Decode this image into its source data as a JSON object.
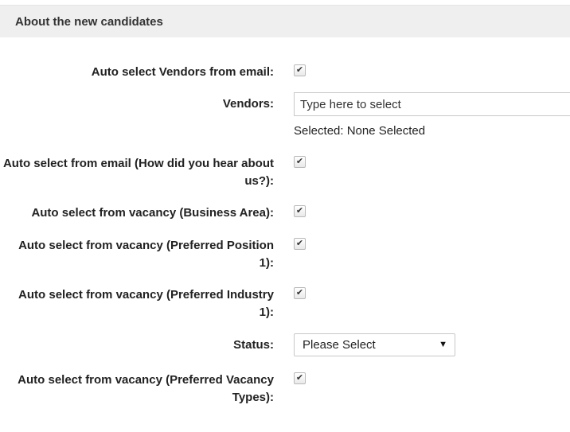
{
  "section": {
    "title": "About the new candidates"
  },
  "fields": {
    "auto_vendors": {
      "label": "Auto select Vendors from email:",
      "checked": true
    },
    "vendors": {
      "label": "Vendors:",
      "placeholder": "Type here to select",
      "selected_text": "Selected: None Selected"
    },
    "auto_hear": {
      "label_line1": "Auto select from email (How did you hear about",
      "label_line2": "us?):",
      "checked": true
    },
    "auto_business_area": {
      "label": "Auto select from vacancy (Business Area):",
      "checked": true
    },
    "auto_pref_position": {
      "label_line1": "Auto select from vacancy (Preferred Position",
      "label_line2": "1):",
      "checked": true
    },
    "auto_pref_industry": {
      "label_line1": "Auto select from vacancy (Preferred Industry",
      "label_line2": "1):",
      "checked": true
    },
    "status": {
      "label": "Status:",
      "value": "Please Select"
    },
    "auto_pref_vacancy_types": {
      "label_line1": "Auto select from vacancy (Preferred Vacancy",
      "label_line2": "Types):",
      "checked": true
    }
  },
  "icons": {
    "check": "✔",
    "dropdown_arrow": "▼"
  }
}
